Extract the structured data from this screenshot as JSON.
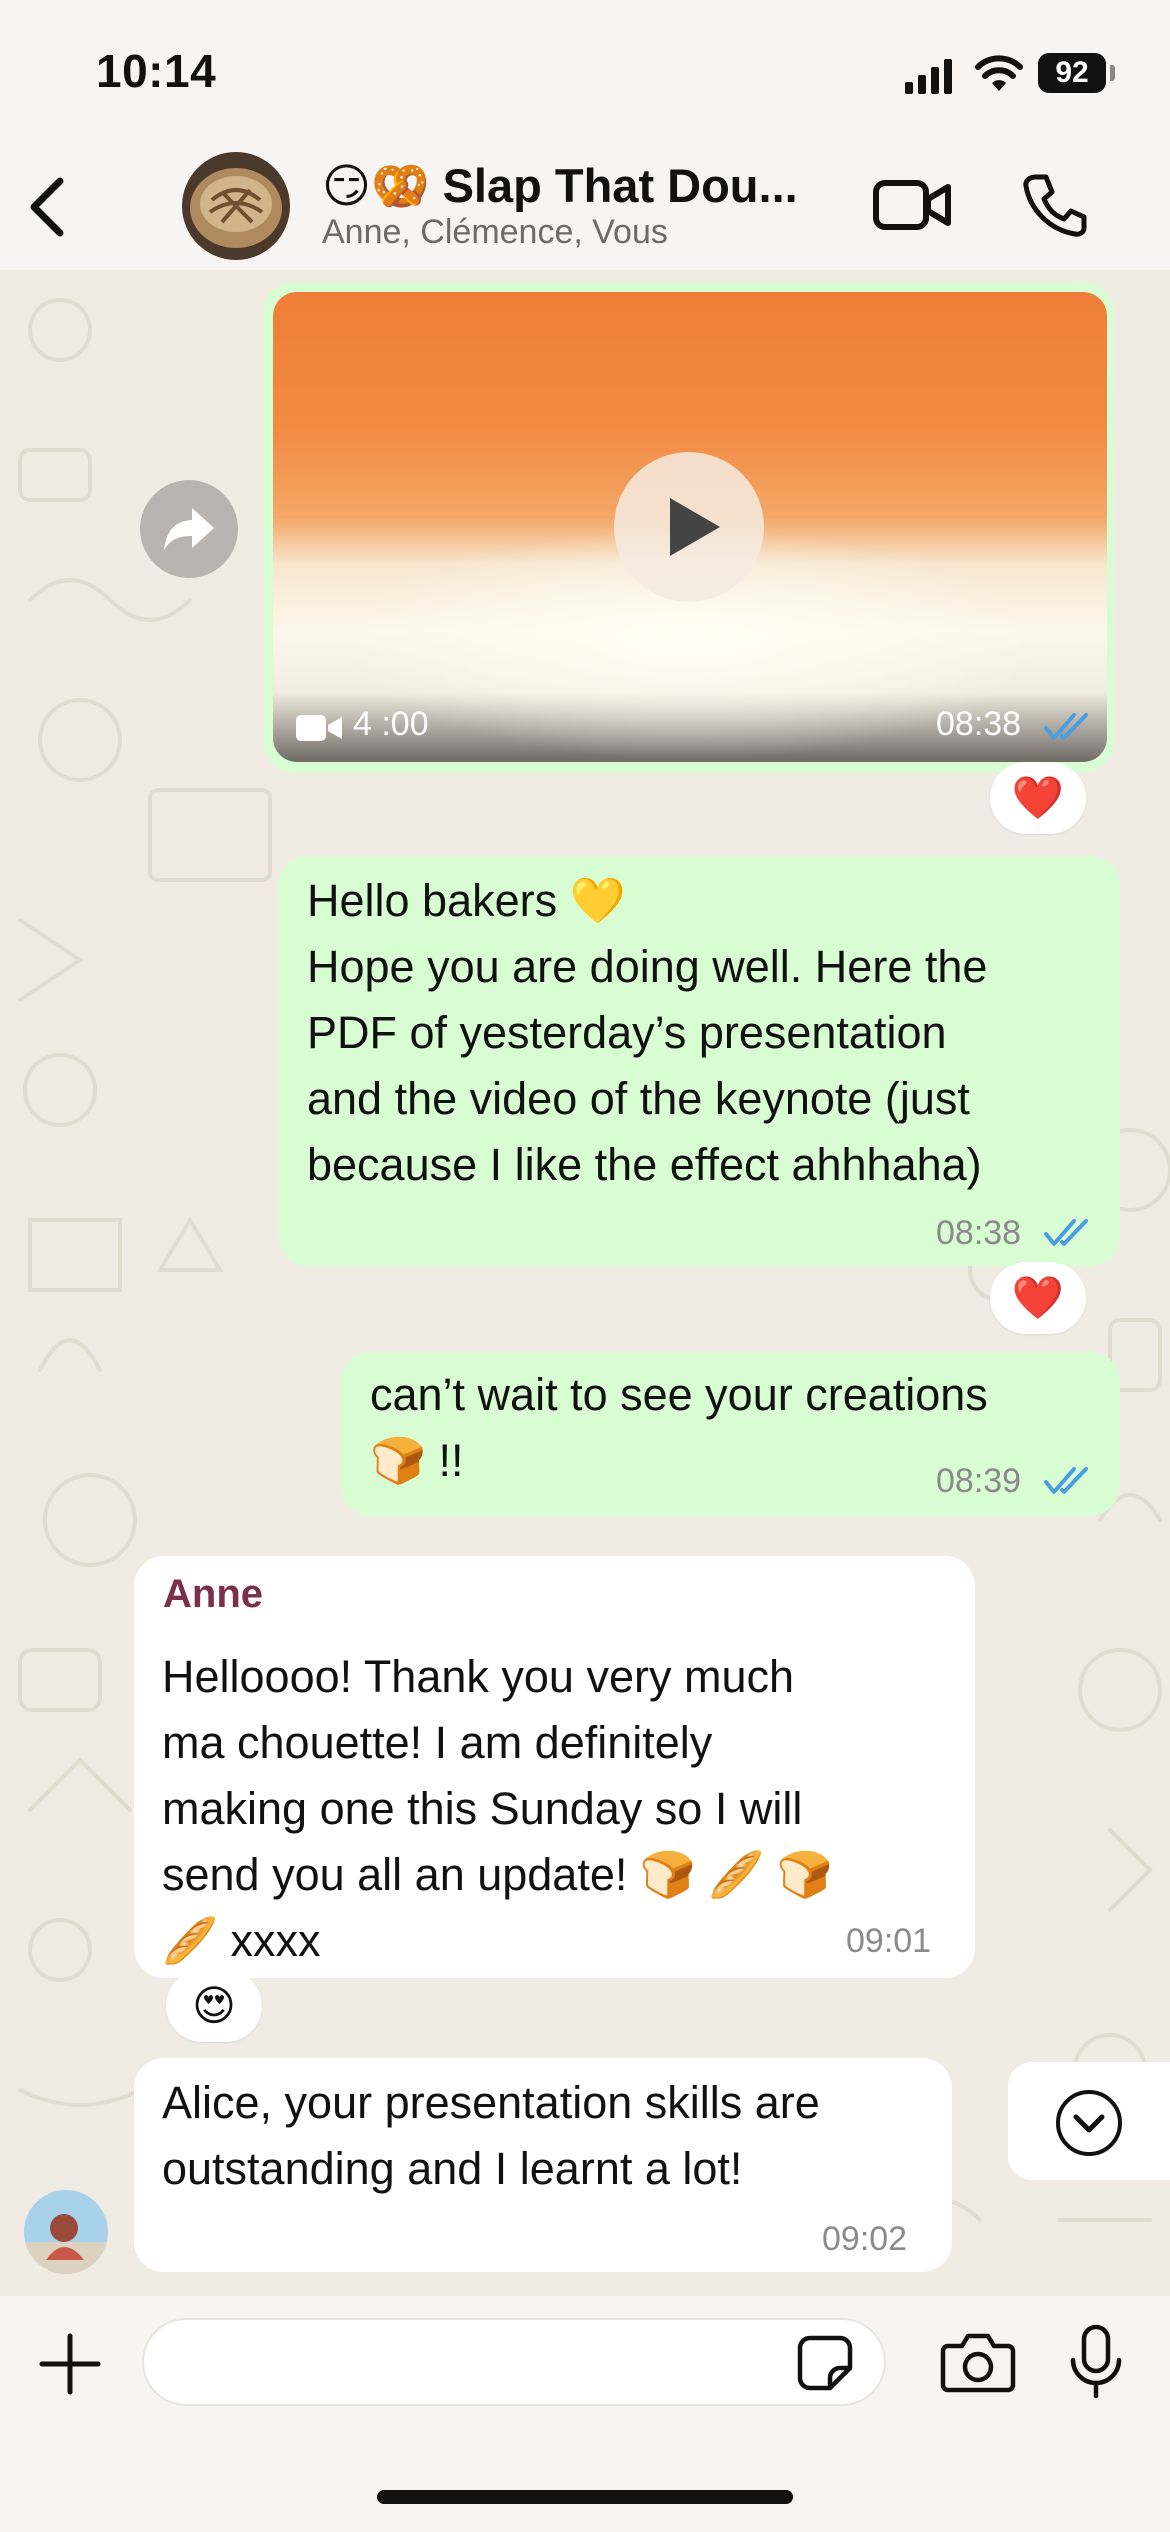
{
  "status_bar": {
    "time": "10:14",
    "battery": "92"
  },
  "header": {
    "title": "😏🥨 Slap That Dou...",
    "members": "Anne, Clémence, Vous"
  },
  "messages": {
    "video": {
      "duration": "4 :00",
      "time": "08:38",
      "reaction": "❤️"
    },
    "hello": {
      "text": "Hello bakers 💛\nHope you are doing well. Here the\nPDF of yesterday’s presentation\nand the video of the keynote (just\nbecause I like the effect ahhhaha)",
      "time": "08:38",
      "reaction": "❤️"
    },
    "cant_wait": {
      "text": "can’t wait to see your creations\n🍞 !!",
      "time": "08:39"
    },
    "anne": {
      "sender": "Anne",
      "text": "Helloooo! Thank you very much\nma chouette! I am definitely\nmaking one this Sunday so I will\nsend you all an update! 🍞 🥖 🍞\n🥖 xxxx",
      "time": "09:01",
      "reaction": "😍"
    },
    "alice": {
      "text": "Alice, your presentation skills are\noutstanding and I learnt a lot!",
      "time": "09:02"
    }
  },
  "input": {
    "placeholder": ""
  },
  "colors": {
    "outgoing_bubble": "#d9fdd3",
    "incoming_bubble": "#ffffff",
    "read_ticks": "#4a9de0",
    "sender_name": "#7a2f4a"
  },
  "icons": [
    "back-icon",
    "video-call-icon",
    "phone-icon",
    "forward-icon",
    "play-icon",
    "video-camera-icon",
    "double-check-icon",
    "chevron-down-icon",
    "plus-icon",
    "sticker-icon",
    "camera-icon",
    "microphone-icon",
    "signal-icon",
    "wifi-icon"
  ]
}
